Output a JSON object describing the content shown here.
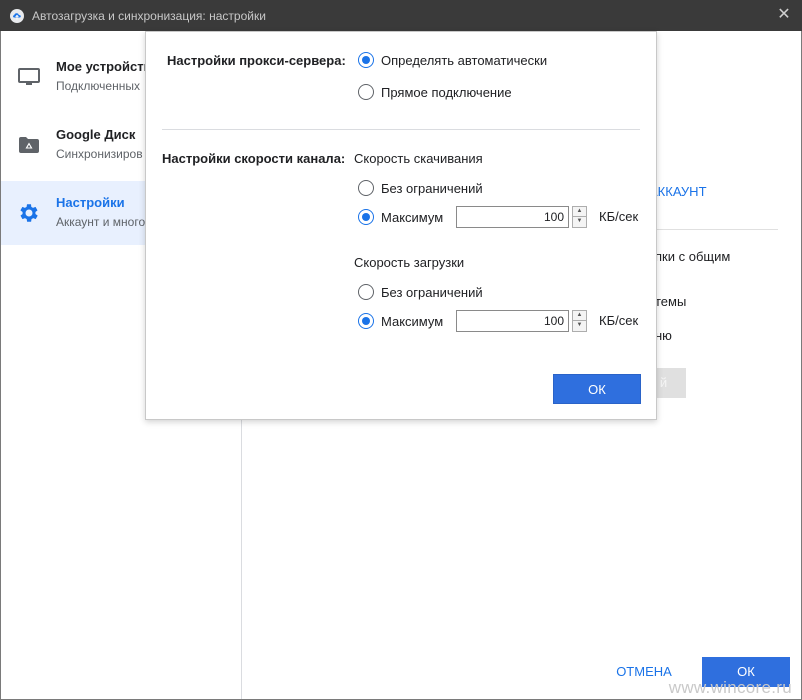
{
  "window": {
    "title": "Автозагрузка и синхронизация: настройки",
    "close_glyph": "✕"
  },
  "sidebar": {
    "items": [
      {
        "title": "Мое устройство",
        "subtitle": "Подключенных",
        "icon": "monitor-icon"
      },
      {
        "title": "Google Диск",
        "subtitle": "Синхронизиров",
        "icon": "drive-folder-icon"
      },
      {
        "title": "Настройки",
        "subtitle": "Аккаунт и много",
        "icon": "gear-icon",
        "active": true
      }
    ]
  },
  "main_background": {
    "account_link": "АККАУНТ",
    "frag1": "пки с общим",
    "frag2": "темы",
    "frag3": "ню",
    "disabled_button": "й"
  },
  "footer": {
    "cancel_label": "ОТМЕНА",
    "ok_label": "ОК"
  },
  "dialog": {
    "proxy": {
      "label": "Настройки прокси-сервера:",
      "options": [
        {
          "label": "Определять автоматически",
          "checked": true
        },
        {
          "label": "Прямое подключение",
          "checked": false
        }
      ]
    },
    "bandwidth": {
      "label": "Настройки скорости канала:",
      "download": {
        "label": "Скорость скачивания",
        "unlimited_label": "Без ограничений",
        "unlimited_checked": false,
        "max_label": "Максимум",
        "max_checked": true,
        "value": "100",
        "unit": "КБ/сек"
      },
      "upload": {
        "label": "Скорость загрузки",
        "unlimited_label": "Без ограничений",
        "unlimited_checked": false,
        "max_label": "Максимум",
        "max_checked": true,
        "value": "100",
        "unit": "КБ/сек"
      }
    },
    "ok_label": "ОК"
  },
  "watermark": "www.wincore.ru",
  "colors": {
    "accent": "#1a73e8",
    "button_blue": "#2f6fde",
    "titlebar": "#3a3a3a",
    "active_nav_bg": "#e8f0fe"
  }
}
